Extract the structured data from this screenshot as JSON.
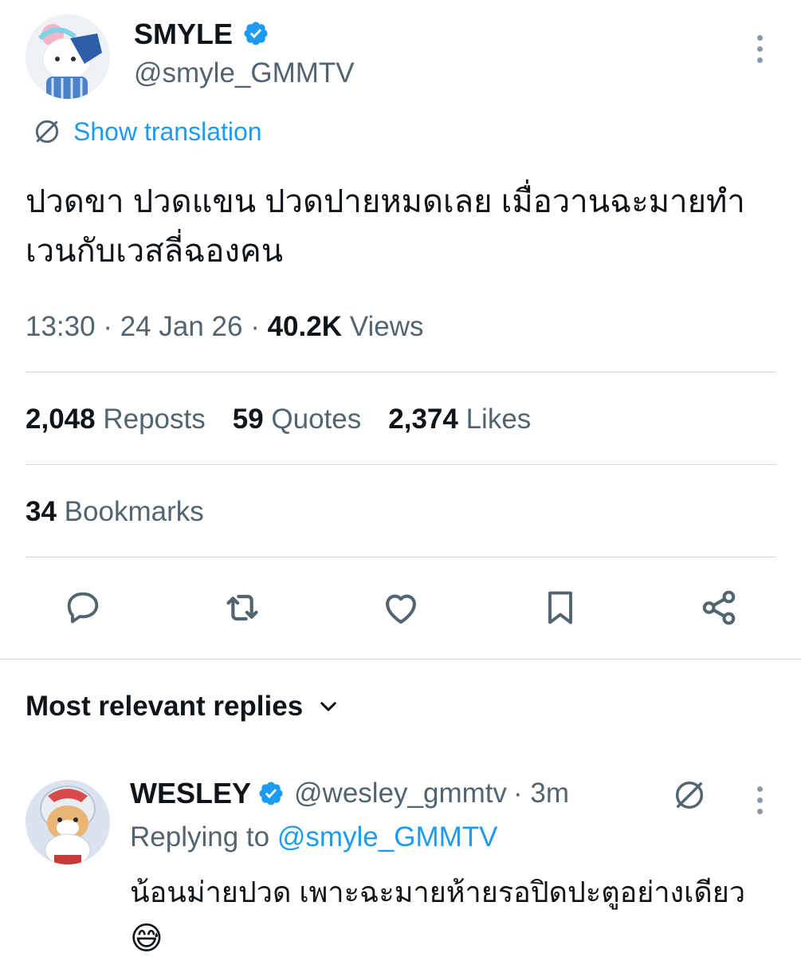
{
  "tweet": {
    "author_name": "SMYLE",
    "author_handle": "@smyle_GMMTV",
    "translate_label": "Show translation",
    "text": "ปวดขา ปวดแขน ปวดปายหมดเลย เมื่อวานฉะมายทำเวนกับเวสลี่ฉองคน",
    "time": "13:30",
    "date": "24 Jan 26",
    "views_count": "40.2K",
    "views_label": "Views",
    "separator": "·"
  },
  "stats": {
    "reposts_count": "2,048",
    "reposts_label": "Reposts",
    "quotes_count": "59",
    "quotes_label": "Quotes",
    "likes_count": "2,374",
    "likes_label": "Likes",
    "bookmarks_count": "34",
    "bookmarks_label": "Bookmarks"
  },
  "actions": [
    "reply-icon",
    "repost-icon",
    "like-icon",
    "bookmark-icon",
    "share-icon"
  ],
  "replies_section": {
    "title": "Most relevant replies"
  },
  "reply": {
    "author_name": "WESLEY",
    "author_handle": "@wesley_gmmtv",
    "time": "· 3m",
    "replying_prefix": "Replying to",
    "replying_handle": "@smyle_GMMTV",
    "text": "น้อนม่ายปวด เพาะฉะมายห้ายรอปิดปะตูอย่างเดียว",
    "emoji": "😅"
  },
  "colors": {
    "accent": "#1d9bf0",
    "text": "#0f1419",
    "secondary": "#536471",
    "divider": "#cfd9de"
  }
}
